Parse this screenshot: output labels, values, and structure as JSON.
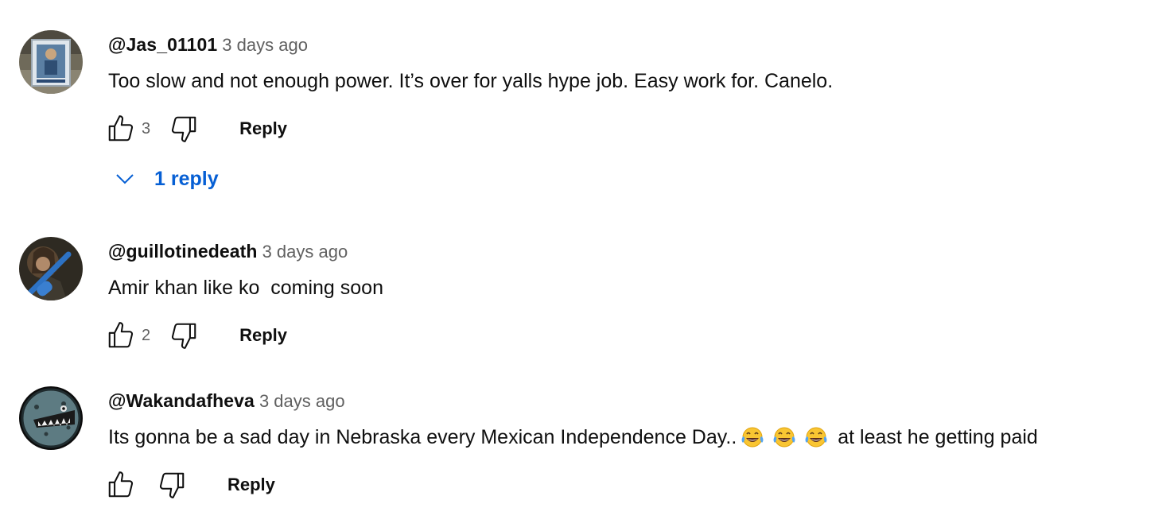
{
  "comments": [
    {
      "author": "@Jas_01101",
      "time": "3 days ago",
      "text": "Too slow and not enough power. It’s over for yalls hype job. Easy work for. Canelo.",
      "likes": "3",
      "reply_label": "Reply",
      "replies_label": "1 reply"
    },
    {
      "author": "@guillotinedeath",
      "time": "3 days ago",
      "text": "Amir khan like ko  coming soon",
      "likes": "2",
      "reply_label": "Reply"
    },
    {
      "author": "@Wakandafheva",
      "time": "3 days ago",
      "text_before_emoji": "Its gonna be a sad day in Nebraska every Mexican Independence Day..",
      "text_after_emoji": " at least he getting paid",
      "emoji": "face-with-tears-of-joy",
      "likes": "",
      "reply_label": "Reply"
    }
  ],
  "icons": {
    "like": "thumbs-up-icon",
    "dislike": "thumbs-down-icon",
    "expand": "chevron-down-icon"
  },
  "colors": {
    "text": "#0f0f0f",
    "secondary": "#606060",
    "link": "#065fd4"
  }
}
